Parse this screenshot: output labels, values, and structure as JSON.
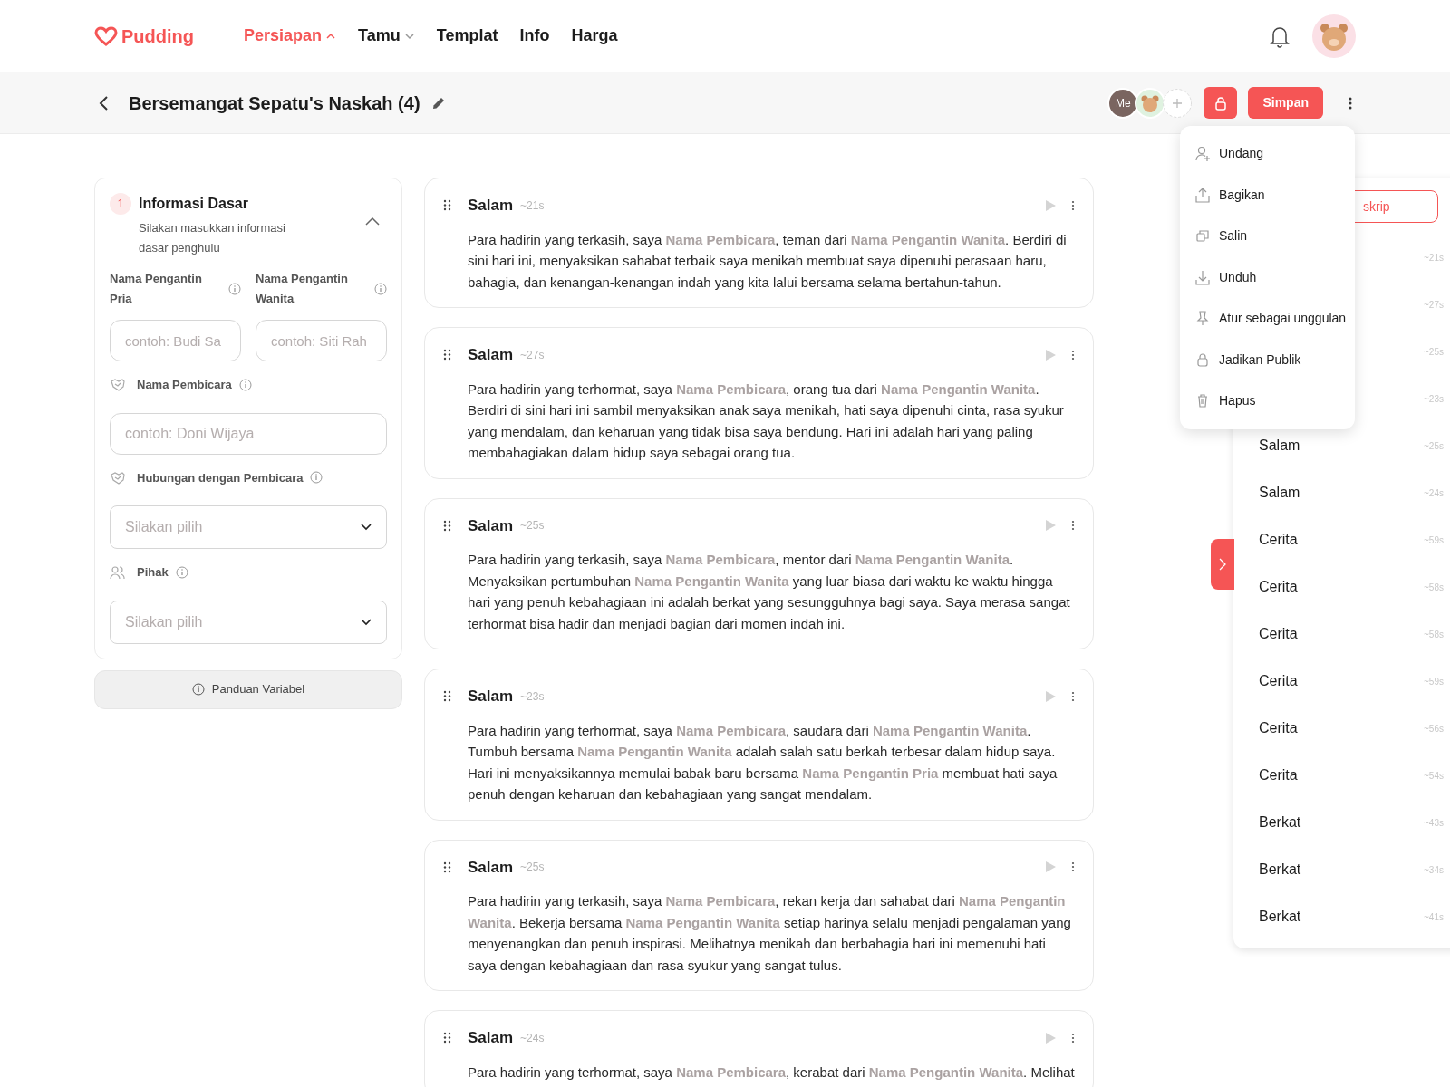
{
  "brand": "Pudding",
  "nav": [
    {
      "label": "Persiapan",
      "selected": true,
      "expanded": true
    },
    {
      "label": "Tamu",
      "selected": false,
      "expanded": false
    },
    {
      "label": "Templat",
      "selected": false
    },
    {
      "label": "Info",
      "selected": false
    },
    {
      "label": "Harga",
      "selected": false
    }
  ],
  "script": {
    "title": "Bersemangat Sepatu's Naskah (4)",
    "collaborators": [
      {
        "kind": "initials",
        "label": "Me"
      },
      {
        "kind": "avatar"
      }
    ],
    "save": "Simpan"
  },
  "menu": [
    {
      "label": "Undang"
    },
    {
      "label": "Bagikan"
    },
    {
      "label": "Salin"
    },
    {
      "label": "Unduh"
    },
    {
      "label": "Atur sebagai unggulan"
    },
    {
      "label": "Jadikan Publik"
    },
    {
      "label": "Hapus"
    }
  ],
  "section": {
    "number": "1",
    "title": "Informasi Dasar",
    "subtitle": "Silakan masukkan informasi dasar penghulu",
    "expanded": true,
    "bride_groom": [
      {
        "label": "Nama Pengantin Pria",
        "placeholder": "contoh: Budi Sa"
      },
      {
        "label": "Nama Pengantin Wanita",
        "placeholder": "contoh: Siti Rah"
      }
    ],
    "fields": [
      {
        "kind": "text",
        "label": "Nama Pembicara",
        "placeholder": "contoh: Doni Wijaya"
      },
      {
        "kind": "select",
        "label": "Hubungan dengan Pembicara",
        "placeholder": "Silakan pilih"
      },
      {
        "kind": "select",
        "label": "Pihak",
        "placeholder": "Silakan pilih"
      }
    ]
  },
  "guide_button": "Panduan Variabel",
  "segments": [
    {
      "title": "Salam",
      "duration": "~21s",
      "text": "Para hadirin yang terkasih, saya **Nama Pembicara**, teman dari **Nama Pengantin Wanita**. Berdiri di sini hari ini, menyaksikan sahabat terbaik saya menikah membuat saya dipenuhi perasaan haru, bahagia, dan kenangan-kenangan indah yang kita lalui bersama selama bertahun-tahun."
    },
    {
      "title": "Salam",
      "duration": "~27s",
      "text": "Para hadirin yang terhormat, saya **Nama Pembicara**, orang tua dari **Nama Pengantin Wanita**. Berdiri di sini hari ini sambil menyaksikan anak saya menikah, hati saya dipenuhi cinta, rasa syukur yang mendalam, dan keharuan yang tidak bisa saya bendung. Hari ini adalah hari yang paling membahagiakan dalam hidup saya sebagai orang tua."
    },
    {
      "title": "Salam",
      "duration": "~25s",
      "text": "Para hadirin yang terkasih, saya **Nama Pembicara**, mentor dari **Nama Pengantin Wanita**. Menyaksikan pertumbuhan **Nama Pengantin Wanita** yang luar biasa dari waktu ke waktu hingga hari yang penuh kebahagiaan ini adalah berkat yang sesungguhnya bagi saya. Saya merasa sangat terhormat bisa hadir dan menjadi bagian dari momen indah ini."
    },
    {
      "title": "Salam",
      "duration": "~23s",
      "text": "Para hadirin yang terhormat, saya **Nama Pembicara**, saudara dari **Nama Pengantin Wanita**. Tumbuh bersama **Nama Pengantin Wanita** adalah salah satu berkah terbesar dalam hidup saya. Hari ini menyaksikannya memulai babak baru bersama **Nama Pengantin Pria** membuat hati saya penuh dengan keharuan dan kebahagiaan yang sangat mendalam."
    },
    {
      "title": "Salam",
      "duration": "~25s",
      "text": "Para hadirin yang terkasih, saya **Nama Pembicara**, rekan kerja dan sahabat dari **Nama Pengantin Wanita**. Bekerja bersama **Nama Pengantin Wanita** setiap harinya selalu menjadi pengalaman yang menyenangkan dan penuh inspirasi. Melihatnya menikah dan berbahagia hari ini memenuhi hati saya dengan kebahagiaan dan rasa syukur yang sangat tulus."
    },
    {
      "title": "Salam",
      "duration": "~24s",
      "text": "Para hadirin yang terhormat, saya **Nama Pembicara**, kerabat dari **Nama Pengantin Wanita**. Melihat"
    }
  ],
  "outline": {
    "button": "skrip",
    "items": [
      {
        "duration": "~21s"
      },
      {
        "duration": "~27s"
      },
      {
        "duration": "~25s"
      },
      {
        "duration": "~23s"
      },
      {
        "title": "Salam",
        "duration": "~25s"
      },
      {
        "title": "Salam",
        "duration": "~24s"
      },
      {
        "title": "Cerita",
        "duration": "~59s"
      },
      {
        "title": "Cerita",
        "duration": "~58s"
      },
      {
        "title": "Cerita",
        "duration": "~58s"
      },
      {
        "title": "Cerita",
        "duration": "~59s"
      },
      {
        "title": "Cerita",
        "duration": "~56s"
      },
      {
        "title": "Cerita",
        "duration": "~54s"
      },
      {
        "title": "Berkat",
        "duration": "~43s"
      },
      {
        "title": "Berkat",
        "duration": "~34s"
      },
      {
        "title": "Berkat",
        "duration": "~41s"
      }
    ]
  }
}
